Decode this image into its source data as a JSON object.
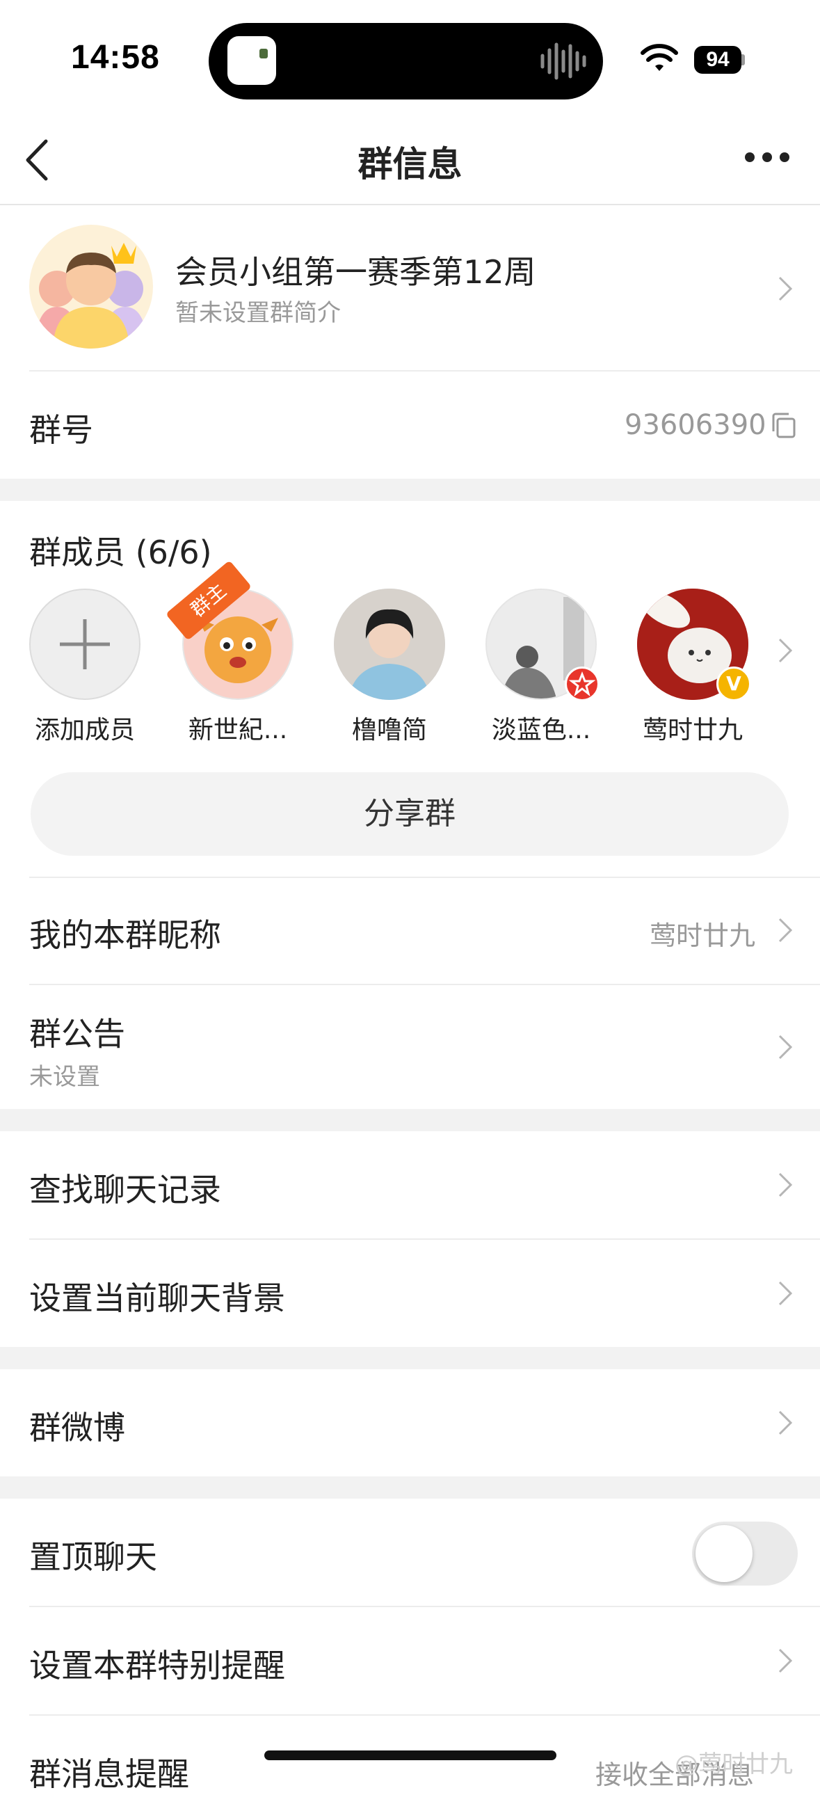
{
  "status_bar": {
    "time": "14:58",
    "battery": "94"
  },
  "nav": {
    "title": "群信息"
  },
  "group": {
    "name": "会员小组第一赛季第12周",
    "description": "暂未设置群简介"
  },
  "group_number": {
    "label": "群号",
    "value": "93606390"
  },
  "members": {
    "title": "群成员 (6/6)",
    "add_label": "添加成员",
    "owner_badge": "群主",
    "list": [
      {
        "name": "新世紀..."
      },
      {
        "name": "橹噜简"
      },
      {
        "name": "淡蓝色..."
      },
      {
        "name": "莺时廿九"
      }
    ]
  },
  "share_label": "分享群",
  "my_nickname": {
    "label": "我的本群昵称",
    "value": "莺时廿九"
  },
  "announcement": {
    "label": "群公告",
    "value": "未设置"
  },
  "find_history": {
    "label": "查找聊天记录"
  },
  "chat_background": {
    "label": "设置当前聊天背景"
  },
  "group_weibo": {
    "label": "群微博"
  },
  "pin_chat": {
    "label": "置顶聊天",
    "enabled": false
  },
  "special_alert": {
    "label": "设置本群特别提醒"
  },
  "message_alert": {
    "label": "群消息提醒",
    "value": "接收全部消息"
  },
  "watermark": "@莺时廿九",
  "colors": {
    "badge": "#f26522",
    "verified": "#f5b400",
    "red_badge": "#e8352b"
  }
}
